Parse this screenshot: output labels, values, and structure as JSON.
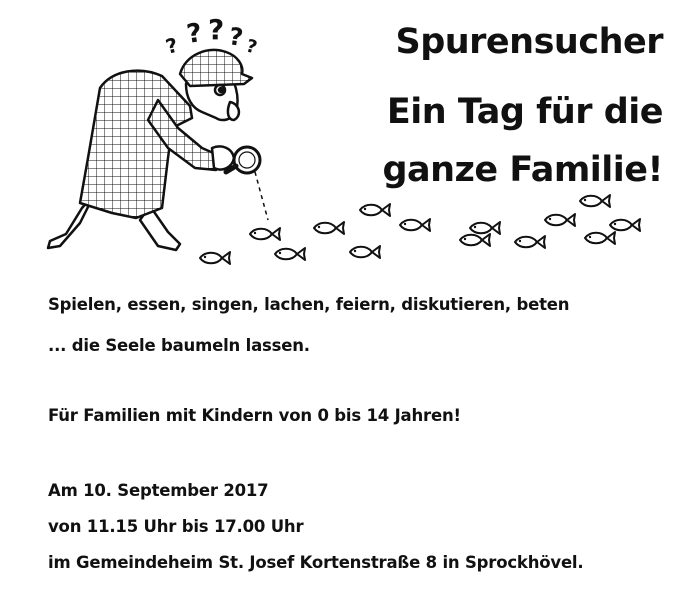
{
  "header": {
    "title": "Spurensucher",
    "subtitle_line1": "Ein Tag für die",
    "subtitle_line2": "ganze Familie!"
  },
  "illustration": {
    "question_marks": "?????",
    "icons": [
      "detective-icon",
      "magnifying-glass-icon",
      "fish-footprint-icon"
    ]
  },
  "body": {
    "activities_line1": "Spielen, essen, singen, lachen, feiern, diskutieren, beten",
    "activities_line2": "... die Seele baumeln lassen.",
    "audience": "Für Familien mit Kindern von 0 bis 14 Jahren!",
    "date": "Am 10. September 2017",
    "time": "von 11.15 Uhr bis 17.00 Uhr",
    "location": "im Gemeindeheim St. Josef Kortenstraße 8 in Sprockhövel."
  },
  "colors": {
    "ink": "#111111",
    "background": "#ffffff"
  }
}
